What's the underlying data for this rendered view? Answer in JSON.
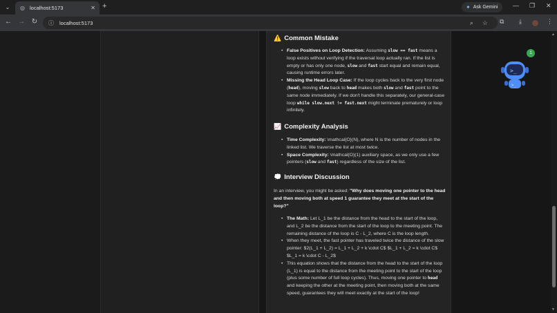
{
  "browser": {
    "tab_title": "localhost:5173",
    "new_tab": "+",
    "ask_gemini": "Ask Gemini",
    "url": "localhost:5173",
    "win_min": "—",
    "win_restore": "❐",
    "win_close": "✕"
  },
  "content": {
    "mistake": {
      "emoji": "⚠️",
      "title": "Common Mistake",
      "item1_head": "False Positives on Loop Detection:",
      "item1_a": " Assuming ",
      "item1_code1": "slow == fast",
      "item1_b": " means a loop exists without verifying if the traversal loop actually ran. If the list is empty or has only one node, ",
      "item1_code2": "slow",
      "item1_c": " and ",
      "item1_code3": "fast",
      "item1_d": " start equal and remain equal, causing runtime errors later.",
      "item2_head": "Missing the Head Loop Case:",
      "item2_a": " If the loop cycles back to the very first node (",
      "item2_code1": "head",
      "item2_b": "), moving ",
      "item2_code2": "slow",
      "item2_c": " back to ",
      "item2_code3": "head",
      "item2_d": " makes both ",
      "item2_code4": "slow",
      "item2_e": " and ",
      "item2_code5": "fast",
      "item2_f": " point to the same node immediately. If we don't handle this separately, our general-case loop ",
      "item2_code6": "while slow.next != fast.next",
      "item2_g": " might terminate prematurely or loop infinitely."
    },
    "complexity": {
      "emoji": "📈",
      "title": "Complexity Analysis",
      "time_head": "Time Complexity:",
      "time_text": " \\mathcal{O}(N), where N is the number of nodes in the linked list. We traverse the list at most twice.",
      "space_head": "Space Complexity:",
      "space_a": " \\mathcal{O}(1) auxiliary space, as we only use a few pointers (",
      "space_code1": "slow",
      "space_b": " and ",
      "space_code2": "fast",
      "space_c": ") regardless of the size of the list."
    },
    "interview": {
      "emoji": "💭",
      "title": "Interview Discussion",
      "intro_a": "In an interview, you might be asked: ",
      "intro_b": "\"Why does moving one pointer to the head and then moving both at speed 1 guarantee they meet at the start of the loop?\"",
      "math_head": "The Math:",
      "math_text": " Let L_1 be the distance from the head to the start of the loop, and L_2 be the distance from the start of the loop to the meeting point. The remaining distance of the loop is C - L_2, where C is the loop length.",
      "meet_text": "When they meet, the fast pointer has traveled twice the distance of the slow pointer: $2(L_1 + L_2) = L_1 + L_2 + k \\cdot C$ $L_1 + L_2 = k \\cdot C$ $L_1 = k \\cdot C - L_2$",
      "eq_a": "This equation shows that the distance from the head to the start of the loop (L_1) is equal to the distance from the meeting point to the start of the loop (plus some number of full loop cycles). Thus, moving one pointer to ",
      "eq_code": "head",
      "eq_b": " and keeping the other at the meeting point, then moving both at the same speed, guarantees they will meet exactly at the start of the loop!"
    }
  },
  "bot_badge": "1",
  "colors": {
    "accent_blue": "#3b82f6",
    "badge_green": "#3aa655"
  }
}
